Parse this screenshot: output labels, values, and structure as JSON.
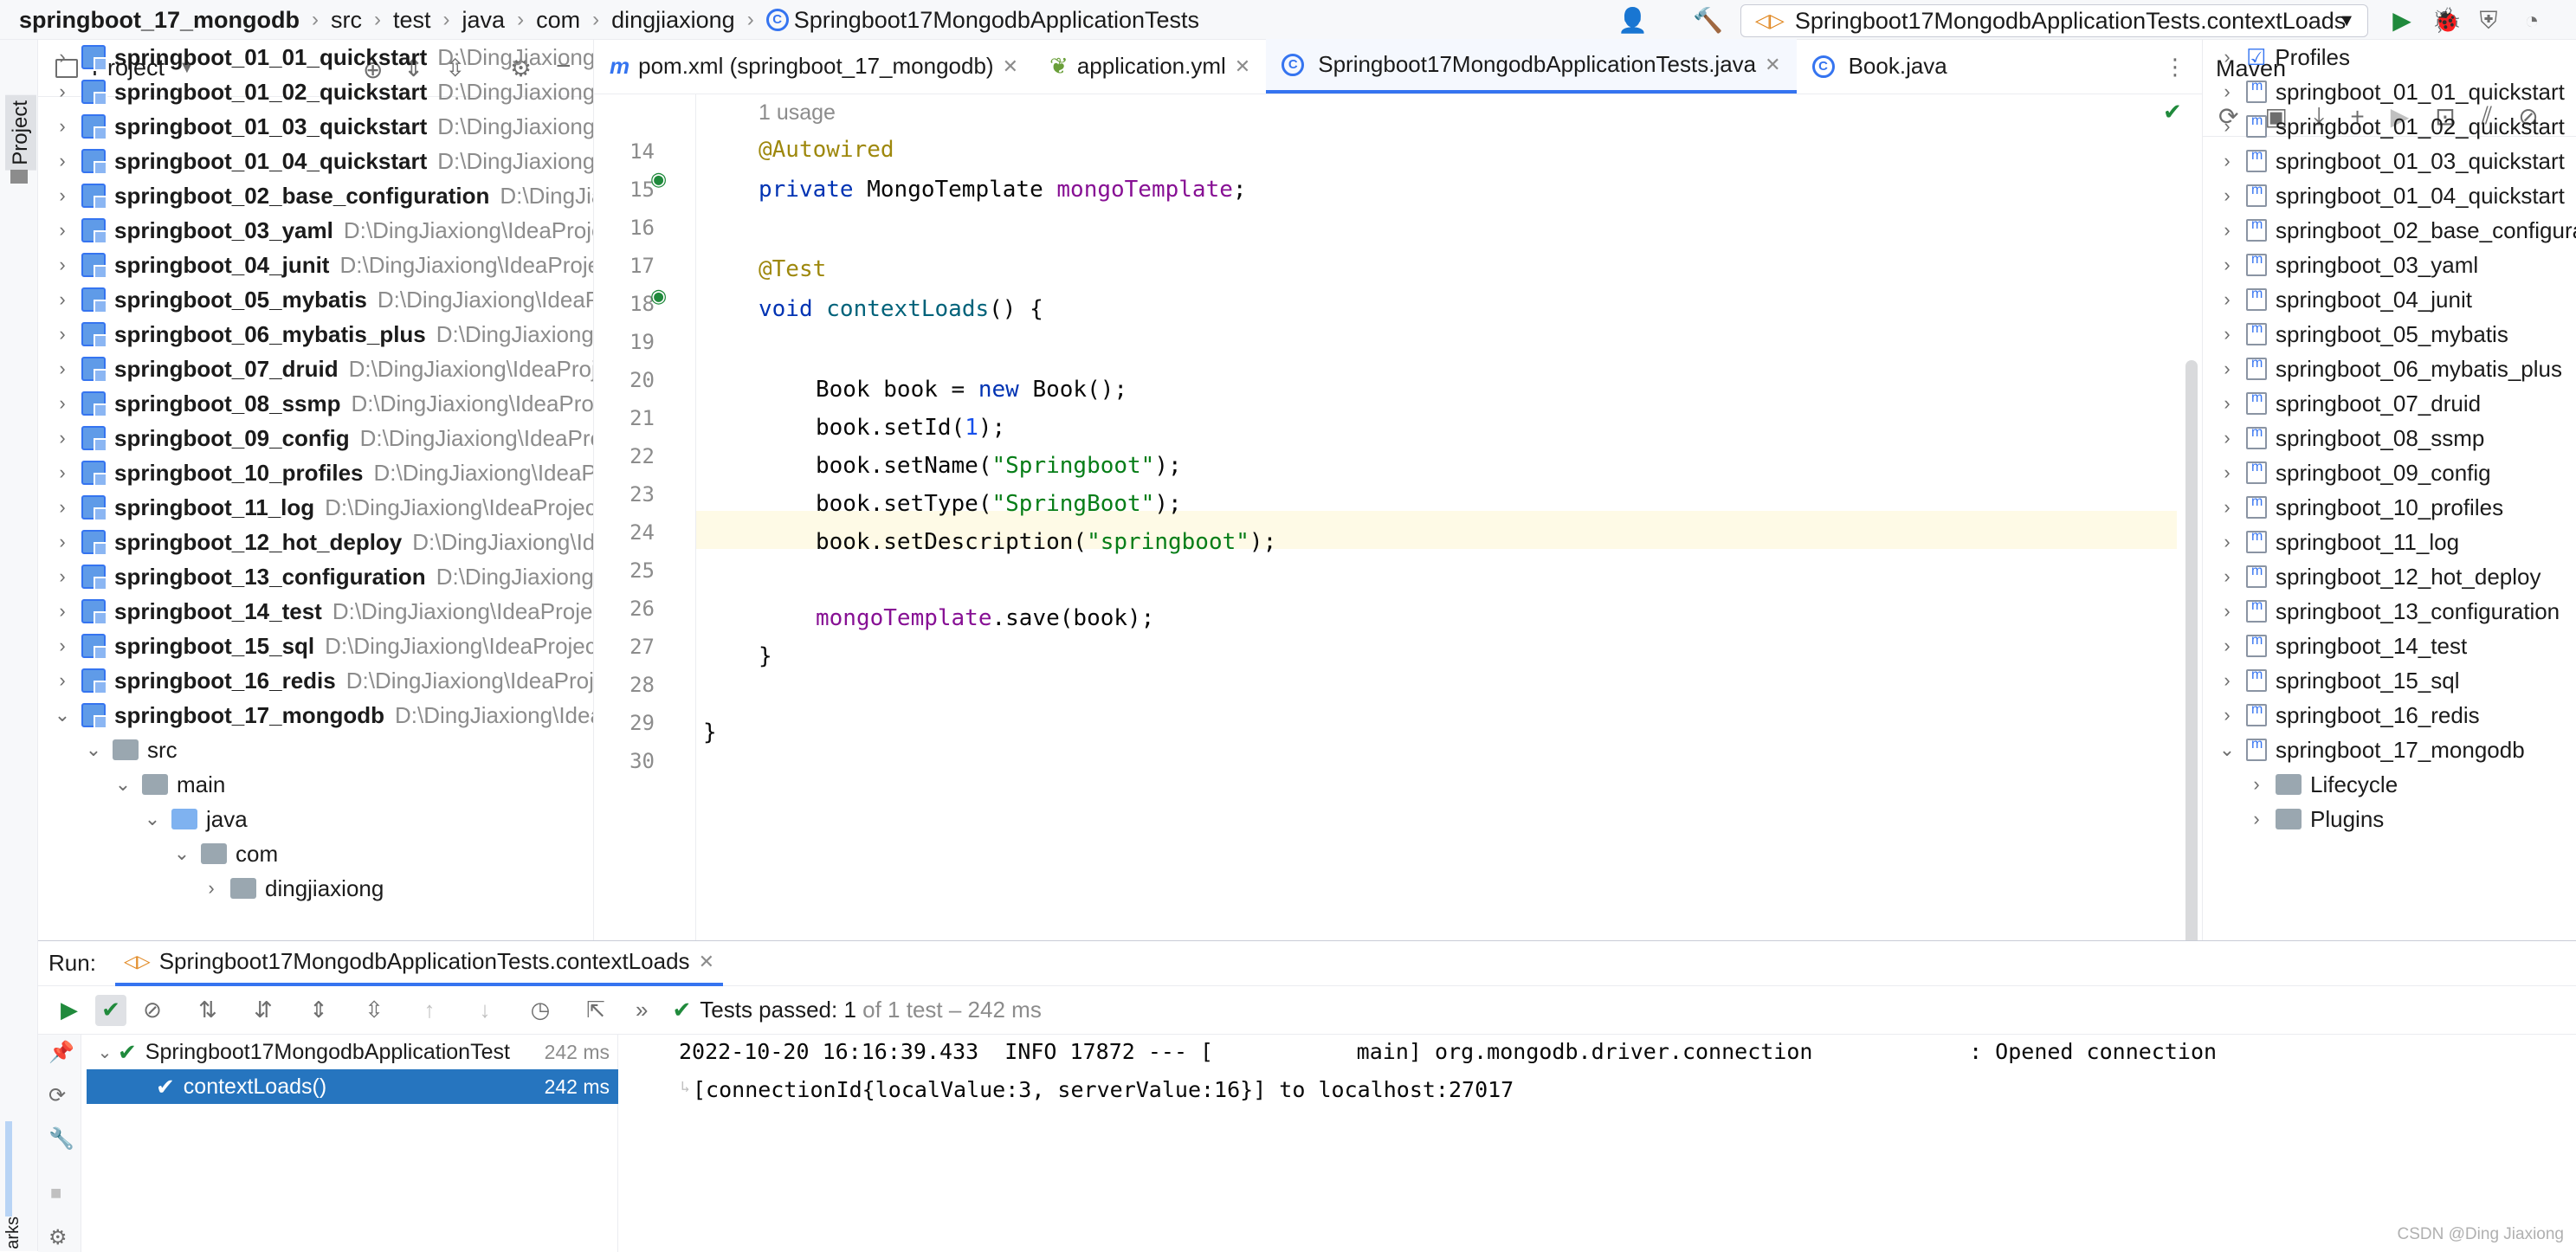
{
  "breadcrumbs": [
    "springboot_17_mongodb",
    "src",
    "test",
    "java",
    "com",
    "dingjiaxiong",
    "Springboot17MongodbApplicationTests"
  ],
  "run_config": "Springboot17MongodbApplicationTests.contextLoads",
  "left_stripe_label": "Project",
  "bottom_stripe_label": "arks",
  "project_panel": {
    "title": "Project",
    "modules": [
      {
        "name": "springboot_01_01_quickstart",
        "path": "D:\\DingJiaxiong\\"
      },
      {
        "name": "springboot_01_02_quickstart",
        "path": "D:\\DingJiaxiong\\"
      },
      {
        "name": "springboot_01_03_quickstart",
        "path": "D:\\DingJiaxiong\\"
      },
      {
        "name": "springboot_01_04_quickstart",
        "path": "D:\\DingJiaxiong\\"
      },
      {
        "name": "springboot_02_base_configuration",
        "path": "D:\\DingJiax"
      },
      {
        "name": "springboot_03_yaml",
        "path": "D:\\DingJiaxiong\\IdeaProje"
      },
      {
        "name": "springboot_04_junit",
        "path": "D:\\DingJiaxiong\\IdeaProje"
      },
      {
        "name": "springboot_05_mybatis",
        "path": "D:\\DingJiaxiong\\IdeaPr"
      },
      {
        "name": "springboot_06_mybatis_plus",
        "path": "D:\\DingJiaxiong\\I"
      },
      {
        "name": "springboot_07_druid",
        "path": "D:\\DingJiaxiong\\IdeaProje"
      },
      {
        "name": "springboot_08_ssmp",
        "path": "D:\\DingJiaxiong\\IdeaProje"
      },
      {
        "name": "springboot_09_config",
        "path": "D:\\DingJiaxiong\\IdeaPro"
      },
      {
        "name": "springboot_10_profiles",
        "path": "D:\\DingJiaxiong\\IdeaPr"
      },
      {
        "name": "springboot_11_log",
        "path": "D:\\DingJiaxiong\\IdeaProject"
      },
      {
        "name": "springboot_12_hot_deploy",
        "path": "D:\\DingJiaxiong\\Ide"
      },
      {
        "name": "springboot_13_configuration",
        "path": "D:\\DingJiaxiong\\"
      },
      {
        "name": "springboot_14_test",
        "path": "D:\\DingJiaxiong\\IdeaProjec"
      },
      {
        "name": "springboot_15_sql",
        "path": "D:\\DingJiaxiong\\IdeaProject"
      },
      {
        "name": "springboot_16_redis",
        "path": "D:\\DingJiaxiong\\IdeaProje"
      },
      {
        "name": "springboot_17_mongodb",
        "path": "D:\\DingJiaxiong\\Idea"
      }
    ],
    "sub_items": [
      "src",
      "main",
      "java",
      "com",
      "dingjiaxiong"
    ]
  },
  "tabs": [
    {
      "label": "pom.xml (springboot_17_mongodb)"
    },
    {
      "label": "application.yml"
    },
    {
      "label": "Springboot17MongodbApplicationTests.java"
    },
    {
      "label": "Book.java"
    }
  ],
  "code": {
    "usage_hint": "1 usage",
    "line_numbers": [
      "14",
      "15",
      "16",
      "17",
      "18",
      "19",
      "20",
      "21",
      "22",
      "23",
      "24",
      "25",
      "26",
      "27",
      "28",
      "29",
      "30"
    ],
    "autowired": "@Autowired",
    "private_kw": "private",
    "mongo_type": "MongoTemplate",
    "mongo_field": "mongoTemplate",
    "semicolon": ";",
    "test_ann": "@Test",
    "void_kw": "void",
    "method_name": "contextLoads",
    "method_tail": "() {",
    "l20_a": "Book book = ",
    "l20_new": "new",
    "l20_b": " Book();",
    "l21_a": "book.setId(",
    "l21_num": "1",
    "l21_b": ");",
    "l22_a": "book.setName(",
    "l22_str": "\"Springboot\"",
    "l22_b": ");",
    "l23_a": "book.setType(",
    "l23_str": "\"SpringBoot\"",
    "l23_b": ");",
    "l24_a": "book.setDescription(",
    "l24_str": "\"springboot\"",
    "l24_b": ");",
    "l26_field": "mongoTemplate",
    "l26_b": ".save(book);",
    "close_method": "}",
    "close_class": "}"
  },
  "maven": {
    "title": "Maven",
    "profiles": "Profiles",
    "modules": [
      "springboot_01_01_quickstart",
      "springboot_01_02_quickstart",
      "springboot_01_03_quickstart",
      "springboot_01_04_quickstart",
      "springboot_02_base_configura",
      "springboot_03_yaml",
      "springboot_04_junit",
      "springboot_05_mybatis",
      "springboot_06_mybatis_plus",
      "springboot_07_druid",
      "springboot_08_ssmp",
      "springboot_09_config",
      "springboot_10_profiles",
      "springboot_11_log",
      "springboot_12_hot_deploy",
      "springboot_13_configuration",
      "springboot_14_test",
      "springboot_15_sql",
      "springboot_16_redis",
      "springboot_17_mongodb"
    ],
    "lifecycle": "Lifecycle",
    "plugins": "Plugins"
  },
  "run": {
    "label": "Run:",
    "tab": "Springboot17MongodbApplicationTests.contextLoads",
    "status_bold": "Tests passed: 1",
    "status_rest": " of 1 test – 242 ms",
    "tree": [
      {
        "label": "Springboot17MongodbApplicationTest",
        "ms": "242 ms"
      },
      {
        "label": "contextLoads()",
        "ms": "242 ms"
      }
    ],
    "console_line1": "2022-10-20 16:16:39.433  INFO 17872 --- [           main] org.mongodb.driver.connection            : Opened connection",
    "console_line2": "[connectionId{localValue:3, serverValue:16}] to localhost:27017"
  },
  "watermark": "CSDN @Ding Jiaxiong",
  "colors": {
    "accent": "#3574f0",
    "selection": "#2675bf",
    "pass": "#208a3c",
    "keyword": "#0033b3",
    "string": "#067d17",
    "field": "#871094",
    "annotation": "#9e880d"
  }
}
